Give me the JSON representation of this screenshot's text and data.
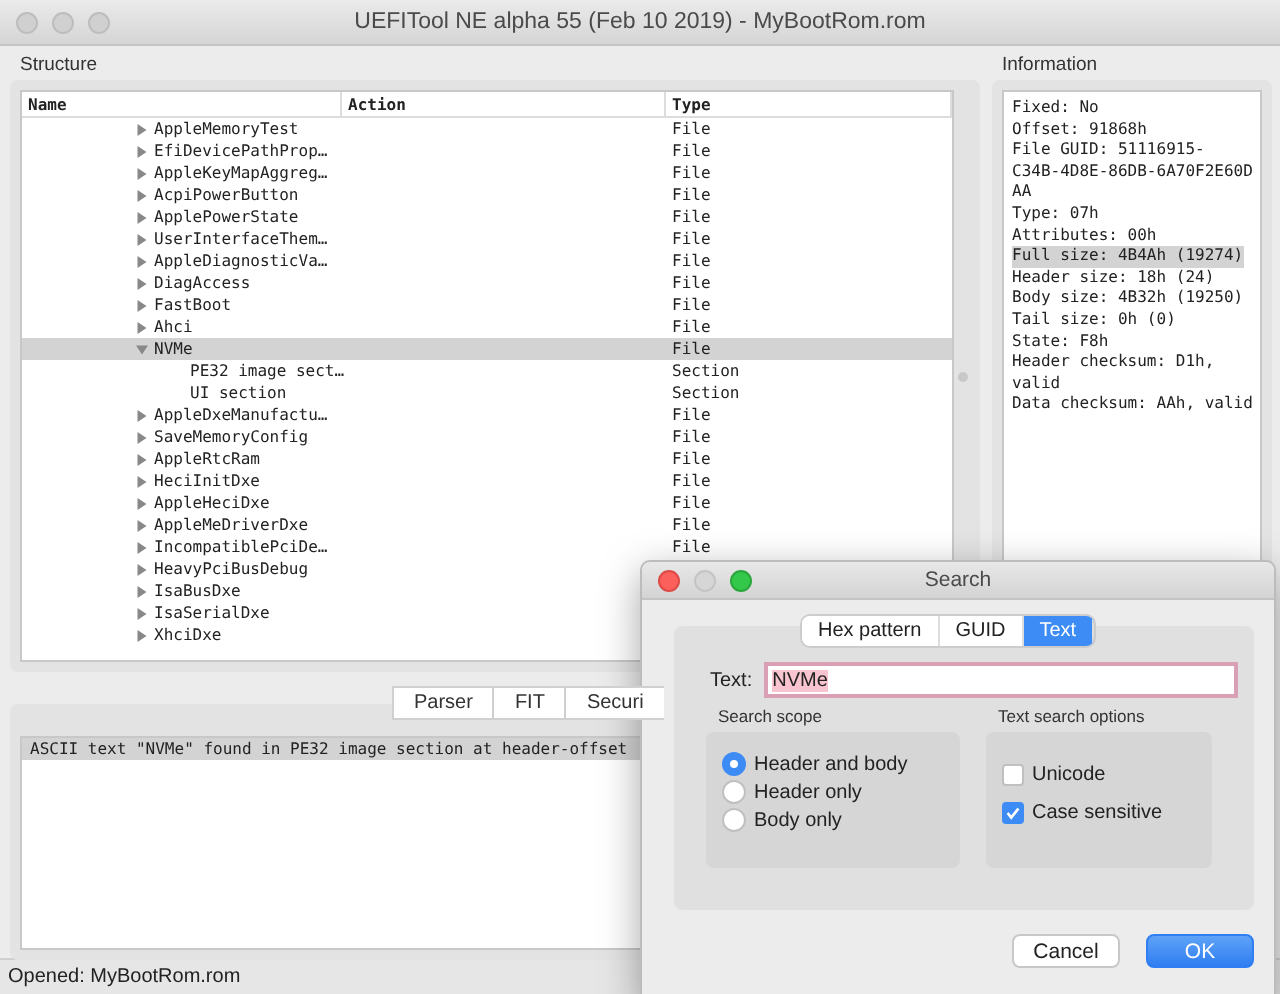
{
  "window": {
    "title": "UEFITool NE alpha 55 (Feb 10 2019) - MyBootRom.rom"
  },
  "structure": {
    "title": "Structure",
    "columns": [
      "Name",
      "Action",
      "Type"
    ],
    "rows": [
      {
        "name": "AppleMemoryTest",
        "type": "File",
        "expanded": false,
        "selected": false
      },
      {
        "name": "EfiDevicePathProp…",
        "type": "File",
        "expanded": false,
        "selected": false
      },
      {
        "name": "AppleKeyMapAggreg…",
        "type": "File",
        "expanded": false,
        "selected": false
      },
      {
        "name": "AcpiPowerButton",
        "type": "File",
        "expanded": false,
        "selected": false
      },
      {
        "name": "ApplePowerState",
        "type": "File",
        "expanded": false,
        "selected": false
      },
      {
        "name": "UserInterfaceThem…",
        "type": "File",
        "expanded": false,
        "selected": false
      },
      {
        "name": "AppleDiagnosticVa…",
        "type": "File",
        "expanded": false,
        "selected": false
      },
      {
        "name": "DiagAccess",
        "type": "File",
        "expanded": false,
        "selected": false
      },
      {
        "name": "FastBoot",
        "type": "File",
        "expanded": false,
        "selected": false
      },
      {
        "name": "Ahci",
        "type": "File",
        "expanded": false,
        "selected": false
      },
      {
        "name": "NVMe",
        "type": "File",
        "expanded": true,
        "selected": true,
        "children": [
          {
            "name": "PE32 image sect…",
            "type": "Section",
            "selected": false
          },
          {
            "name": "UI section",
            "type": "Section",
            "selected": false
          }
        ]
      },
      {
        "name": "AppleDxeManufactu…",
        "type": "File",
        "expanded": false,
        "selected": false
      },
      {
        "name": "SaveMemoryConfig",
        "type": "File",
        "expanded": false,
        "selected": false
      },
      {
        "name": "AppleRtcRam",
        "type": "File",
        "expanded": false,
        "selected": false
      },
      {
        "name": "HeciInitDxe",
        "type": "File",
        "expanded": false,
        "selected": false
      },
      {
        "name": "AppleHeciDxe",
        "type": "File",
        "expanded": false,
        "selected": false
      },
      {
        "name": "AppleMeDriverDxe",
        "type": "File",
        "expanded": false,
        "selected": false
      },
      {
        "name": "IncompatiblePciDe…",
        "type": "File",
        "expanded": false,
        "selected": false
      },
      {
        "name": "HeavyPciBusDebug",
        "expanded": false,
        "selected": false
      },
      {
        "name": "IsaBusDxe",
        "expanded": false,
        "selected": false
      },
      {
        "name": "IsaSerialDxe",
        "expanded": false,
        "selected": false
      },
      {
        "name": "XhciDxe",
        "expanded": false,
        "selected": false
      }
    ]
  },
  "information": {
    "title": "Information",
    "lines": [
      {
        "text": "Fixed: No",
        "selected": false
      },
      {
        "text": "Offset: 91868h",
        "selected": false
      },
      {
        "text": "File GUID: 51116915-",
        "selected": false
      },
      {
        "text": "C34B-4D8E-86DB-6A70F2E60D",
        "selected": false
      },
      {
        "text": "AA",
        "selected": false
      },
      {
        "text": "Type: 07h",
        "selected": false
      },
      {
        "text": "Attributes: 00h",
        "selected": false
      },
      {
        "text": "Full size: 4B4Ah (19274)",
        "selected": true
      },
      {
        "text": "Header size: 18h (24)",
        "selected": false
      },
      {
        "text": "Body size: 4B32h (19250)",
        "selected": false
      },
      {
        "text": "Tail size: 0h (0)",
        "selected": false
      },
      {
        "text": "State: F8h",
        "selected": false
      },
      {
        "text": "Header checksum: D1h,",
        "selected": false
      },
      {
        "text": "valid",
        "selected": false
      },
      {
        "text": "Data checksum: AAh, valid",
        "selected": false
      }
    ]
  },
  "messages": {
    "tabs": [
      "Parser",
      "FIT",
      "Securi"
    ],
    "items": [
      {
        "text": "ASCII text \"NVMe\" found in PE32 image section at header-offset",
        "selected": true
      }
    ]
  },
  "status_bar": "Opened: MyBootRom.rom",
  "search_dialog": {
    "title": "Search",
    "tabs": [
      {
        "label": "Hex pattern",
        "selected": false
      },
      {
        "label": "GUID",
        "selected": false
      },
      {
        "label": "Text",
        "selected": true
      }
    ],
    "text_label": "Text:",
    "text_value": "NVMe",
    "scope": {
      "title": "Search scope",
      "options": [
        {
          "label": "Header and body",
          "selected": true
        },
        {
          "label": "Header only",
          "selected": false
        },
        {
          "label": "Body only",
          "selected": false
        }
      ]
    },
    "options": {
      "title": "Text search options",
      "items": [
        {
          "label": "Unicode",
          "checked": false
        },
        {
          "label": "Case sensitive",
          "checked": true
        }
      ]
    },
    "buttons": [
      {
        "label": "Cancel",
        "kind": "secondary"
      },
      {
        "label": "OK",
        "kind": "primary"
      }
    ]
  }
}
